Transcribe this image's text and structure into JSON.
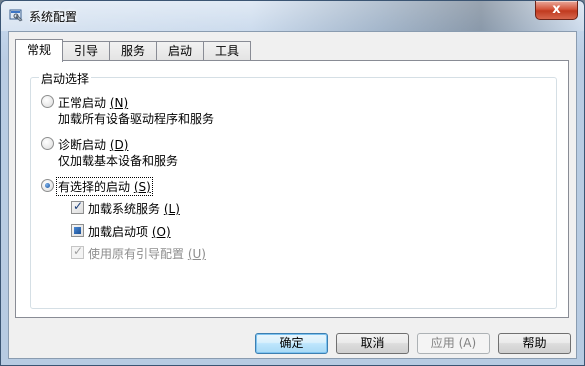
{
  "window": {
    "title": "系统配置",
    "close_label": "x"
  },
  "tabs": [
    {
      "label": "常规",
      "active": true
    },
    {
      "label": "引导",
      "active": false
    },
    {
      "label": "服务",
      "active": false
    },
    {
      "label": "启动",
      "active": false
    },
    {
      "label": "工具",
      "active": false
    }
  ],
  "startup_group": {
    "label": "启动选择",
    "options": [
      {
        "label": "正常启动 (N)",
        "label_text": "正常启动 ",
        "accel": "(N)",
        "desc": "加载所有设备驱动程序和服务",
        "selected": false
      },
      {
        "label": "诊断启动 (D)",
        "label_text": "诊断启动 ",
        "accel": "(D)",
        "desc": "仅加载基本设备和服务",
        "selected": false
      },
      {
        "label": "有选择的启动 (S)",
        "label_text": "有选择的启动 ",
        "accel": "(S)",
        "selected": true
      }
    ],
    "checkboxes": [
      {
        "label_text": "加载系统服务 ",
        "accel": "(L)",
        "state": "checked",
        "enabled": true
      },
      {
        "label_text": "加载启动项 ",
        "accel": "(O)",
        "state": "indeterminate",
        "enabled": true
      },
      {
        "label_text": "使用原有引导配置 ",
        "accel": "(U)",
        "state": "checked",
        "enabled": false
      }
    ]
  },
  "buttons": {
    "ok": "确定",
    "cancel": "取消",
    "apply": "应用 (A)",
    "help": "帮助"
  },
  "colors": {
    "titlebar": "#c3d5ea",
    "close_button": "#c03a1f",
    "default_button_border": "#3c7fb1"
  }
}
